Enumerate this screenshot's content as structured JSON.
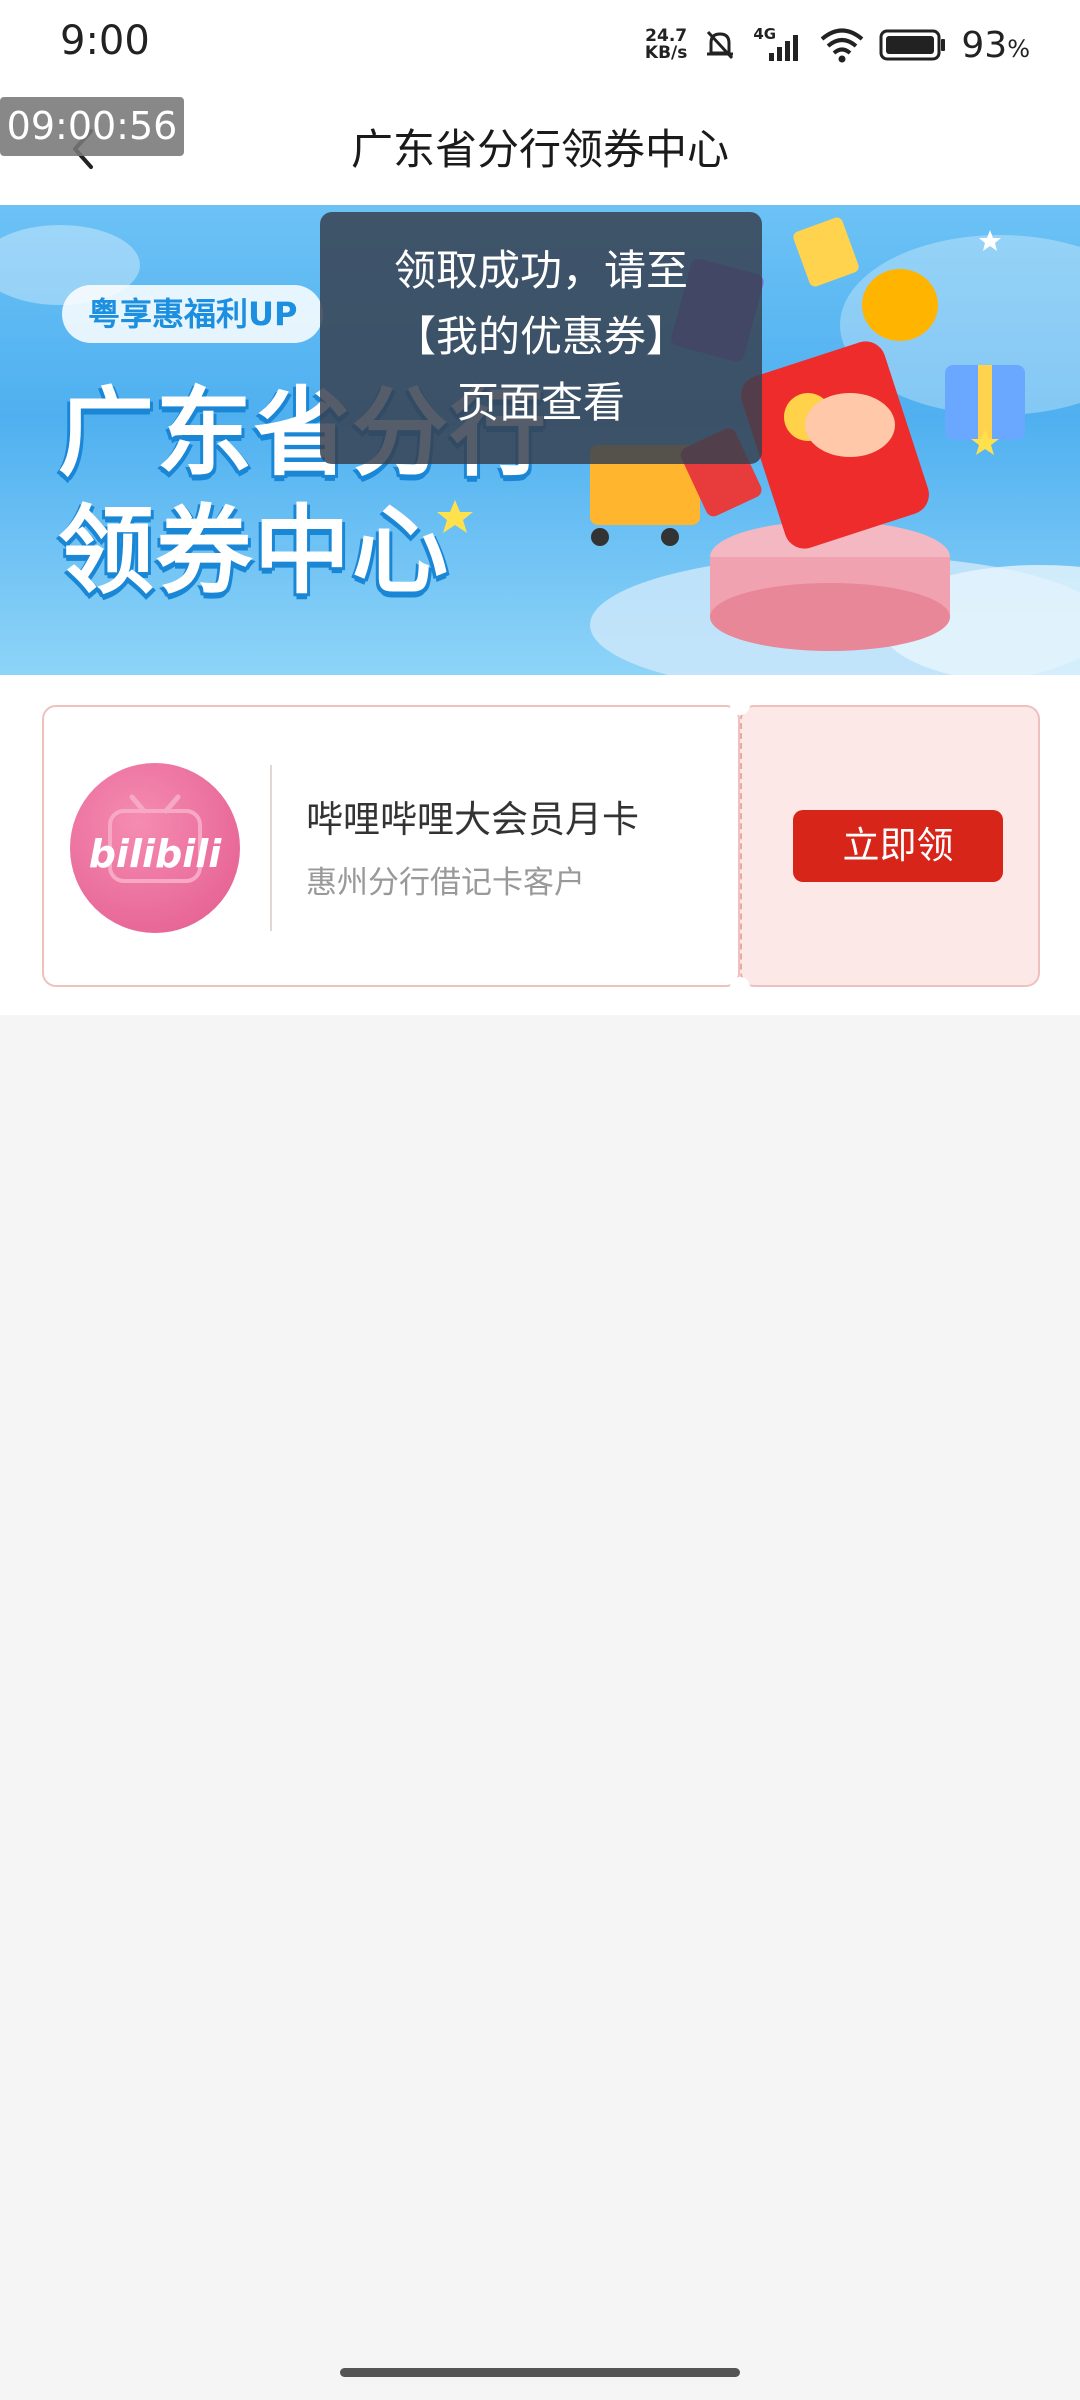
{
  "status_bar": {
    "time": "9:00",
    "net_speed_value": "24.7",
    "net_speed_unit": "KB/s",
    "network": "4G",
    "battery_percent": "93",
    "battery_symbol": "%",
    "icons": [
      "mute-bell-icon",
      "signal-icon",
      "wifi-icon",
      "battery-icon"
    ]
  },
  "header": {
    "title": "广东省分行领券中心",
    "back_icon": "chevron-left-icon"
  },
  "recording_time": "09:00:56",
  "banner": {
    "tag": "粤享惠福利UP",
    "title_line1": "广东省分行",
    "title_line2": "领券中心"
  },
  "toast": {
    "line1": "领取成功，请至",
    "line2": "【我的优惠券】",
    "line3": "页面查看"
  },
  "coupon": {
    "logo_text": "bilibili",
    "title": "哔哩哔哩大会员月卡",
    "subtitle": "惠州分行借记卡客户",
    "button": "立即领"
  },
  "colors": {
    "accent_red": "#d7251a",
    "coupon_bg": "#fbe8e7",
    "banner_blue": "#4fb0f0",
    "bili_pink": "#e35a8e"
  }
}
